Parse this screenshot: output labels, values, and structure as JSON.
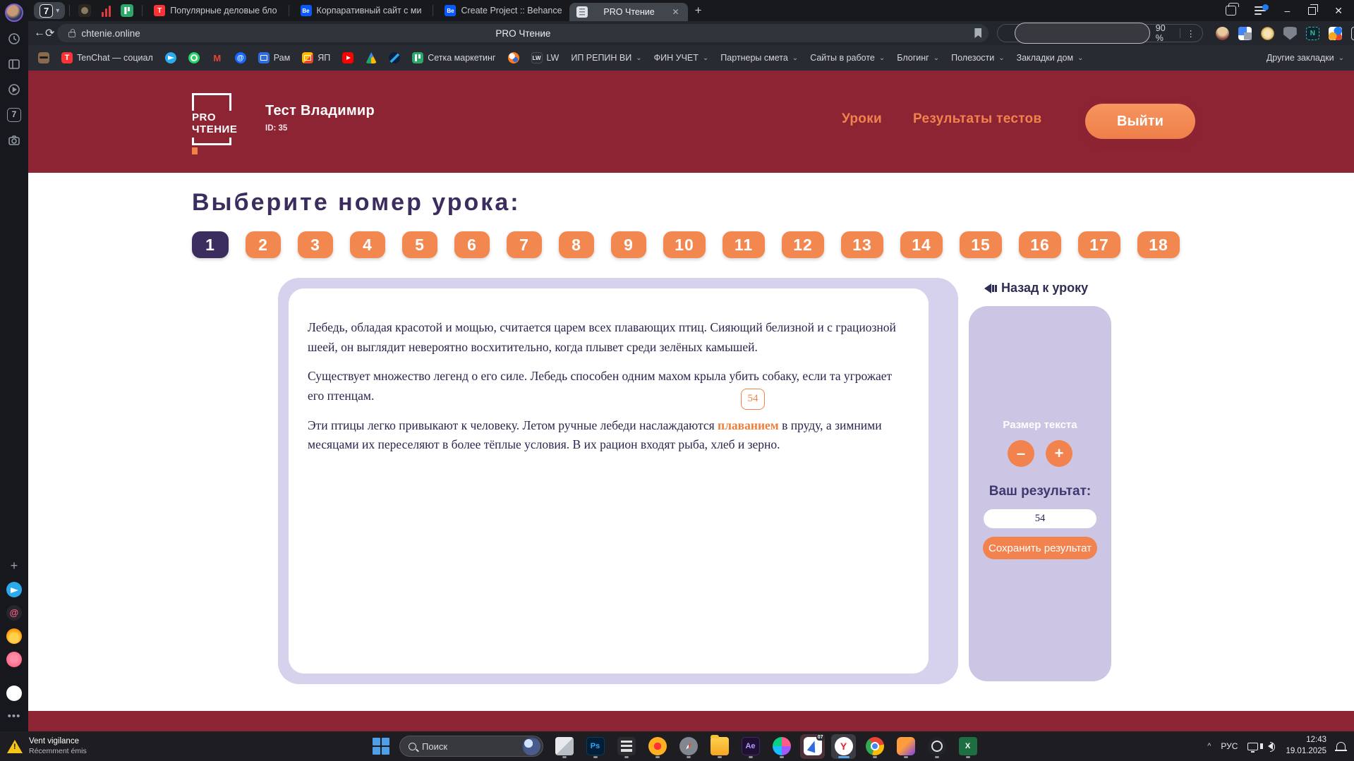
{
  "browser": {
    "tab_counter": "7",
    "pinned_tabs": [
      "dark-app",
      "red-chart",
      "green-board"
    ],
    "tabs": [
      {
        "title": "Популярные деловые бло",
        "icon": "tenchat"
      },
      {
        "title": "Корпаративный сайт с ми",
        "icon": "behance"
      },
      {
        "title": "Create Project :: Behance",
        "icon": "behance"
      },
      {
        "title": "PRO Чтение",
        "icon": "site-document",
        "active": true,
        "close": "✕"
      }
    ],
    "new_tab": "+",
    "window_controls": {
      "minimize": "–",
      "close": "✕"
    },
    "toolbar": {
      "back": "←",
      "reload": "⟳",
      "domain": "chtenie.online",
      "page_title": "PRO Чтение",
      "zoom_level": "90 %",
      "menu_dots": "⋮"
    },
    "extensions": [
      "character",
      "translate",
      "gold-coin",
      "shield",
      "notion-clip",
      "people-id",
      "tabs-panel",
      "download"
    ],
    "bookmarks": {
      "items": [
        {
          "icon": "cat",
          "label": ""
        },
        {
          "icon": "tenchat",
          "label": "TenChat — социал"
        },
        {
          "icon": "telegram",
          "label": ""
        },
        {
          "icon": "whatsapp",
          "label": ""
        },
        {
          "icon": "gmail",
          "label": ""
        },
        {
          "icon": "mailru-at",
          "label": ""
        },
        {
          "icon": "mail-blue",
          "label": "Рам"
        },
        {
          "icon": "mail-yellow",
          "label": "ЯП"
        },
        {
          "icon": "youtube",
          "label": ""
        },
        {
          "icon": "google-drive",
          "label": ""
        },
        {
          "icon": "swoosh",
          "label": ""
        },
        {
          "icon": "green-grid",
          "label": "Сетка маркетинг"
        },
        {
          "icon": "orange-dot",
          "label": ""
        },
        {
          "icon": "lw",
          "label": "LW"
        }
      ],
      "folders": [
        "ИП РЕПИН ВИ",
        "ФИН УЧЕТ",
        "Партнеры смета",
        "Сайты в работе",
        "Блогинг",
        "Полезости",
        "Закладки дом"
      ],
      "other": "Другие закладки",
      "chevron": "⌄"
    }
  },
  "icons": {
    "behance_glyph": "Be",
    "tenchat_glyph": "T",
    "gmail_glyph": "M",
    "mailru_glyph": "@",
    "lw_glyph": "LW",
    "notion_glyph": "N",
    "photoshop_glyph": "Ps",
    "after_effects_glyph": "Ae",
    "yandex_glyph": "Y",
    "excel_glyph": "X",
    "start_badge": "07",
    "rail_tab_count": "7",
    "plus_glyph": "+",
    "more_glyph": "•••",
    "at_glyph": "@"
  },
  "site": {
    "header": {
      "logo_text": "PRO\nЧТЕНИЕ",
      "user_name": "Тест Владимир",
      "user_id": "ID: 35",
      "nav": [
        "Уроки",
        "Результаты тестов"
      ],
      "logout": "Выйти"
    },
    "lesson_picker": {
      "heading": "Выберите номер урока:",
      "selected": "1",
      "lessons": [
        "1",
        "2",
        "3",
        "4",
        "5",
        "6",
        "7",
        "8",
        "9",
        "10",
        "11",
        "12",
        "13",
        "14",
        "15",
        "16",
        "17",
        "18"
      ]
    },
    "reading": {
      "p1": "Лебедь, обладая красотой и мощью, считается царем всех плавающих птиц. Сияющий белизной и с грациозной шеей, он выглядит невероятно восхитительно, когда плывет среди зелёных камышей.",
      "p2": "Существует множество легенд о его силе. Лебедь способен одним махом крыла убить собаку, если та угрожает его птенцам.",
      "p3_before": "Эти птицы легко привыкают к человеку. Летом ручные лебеди наслаждаются ",
      "p3_highlight": "плаванием",
      "p3_after": " в пруду, а зимними месяцами их переселяют в более тёплые условия. В их рацион входят рыба, хлеб и зерно.",
      "counter_badge": "54"
    },
    "side_panel": {
      "back_link": "Назад к уроку",
      "text_size_label": "Размер текста",
      "minus": "–",
      "plus": "+",
      "result_label": "Ваш результат:",
      "result_value": "54",
      "save_button": "Сохранить результат"
    }
  },
  "taskbar": {
    "notification": {
      "title": "Vent vigilance",
      "subtitle": "Récemment émis"
    },
    "search_placeholder": "Поиск",
    "apps": [
      "start",
      "preview",
      "photoshop",
      "calculator",
      "yandex-music",
      "compass-browser",
      "file-explorer",
      "after-effects",
      "figma",
      "yandex-start",
      "yandex-browser",
      "chrome",
      "phone-app",
      "obs",
      "excel"
    ],
    "tray": {
      "expand": "^",
      "lang": "РУС",
      "time": "12:43",
      "date": "19.01.2025"
    }
  },
  "colors": {
    "site_red": "#8d2434",
    "site_orange": "#f28750",
    "site_purple": "#3b2e5e",
    "lavender": "#d6d1ec",
    "chrome_dark": "#17191d",
    "taskbar": "#1d1d22"
  }
}
